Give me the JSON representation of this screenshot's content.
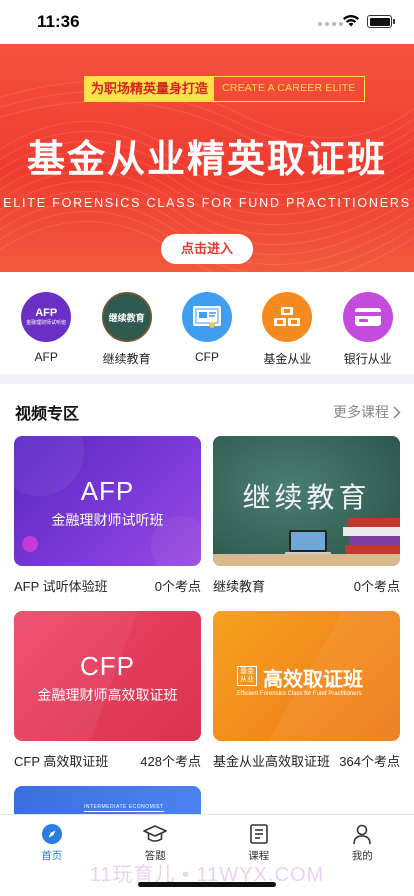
{
  "status": {
    "time": "11:36"
  },
  "banner": {
    "tag_cn": "为职场精英量身打造",
    "tag_en": "CREATE A CAREER ELITE",
    "title": "基金从业精英取证班",
    "subtitle": "ELITE FORENSICS CLASS FOR FUND PRACTITIONERS",
    "button": "点击进入",
    "colors": {
      "bg": "#ee3c30",
      "accent": "#ffe14a"
    }
  },
  "categories": [
    {
      "label": "AFP",
      "icon": "afp-badge-icon",
      "badge_title": "AFP",
      "badge_sub": "金融理财师试听班",
      "color": "#6a2fc4"
    },
    {
      "label": "继续教育",
      "icon": "chalkboard-icon",
      "badge_title": "继续教育",
      "color": "#2f5a4e"
    },
    {
      "label": "CFP",
      "icon": "certificate-icon",
      "color": "#3f9ef0"
    },
    {
      "label": "基金从业",
      "icon": "gold-bars-icon",
      "color": "#f58a1f"
    },
    {
      "label": "银行从业",
      "icon": "bank-card-icon",
      "color": "#c44bdb"
    }
  ],
  "video_section": {
    "title": "视频专区",
    "more": "更多课程"
  },
  "courses": [
    {
      "name": "AFP 试听体验班",
      "count": "0个考点",
      "thumb_title": "AFP",
      "thumb_sub": "金融理财师试听班"
    },
    {
      "name": "继续教育",
      "count": "0个考点",
      "thumb_title": "继续教育"
    },
    {
      "name": "CFP 高效取证班",
      "count": "428个考点",
      "thumb_title": "CFP",
      "thumb_sub": "金融理财师高效取证班"
    },
    {
      "name": "基金从业高效取证班",
      "count": "364个考点",
      "thumb_title": "高效取证班",
      "thumb_logo": "基金从业",
      "thumb_sub": "Efficient Forensics Class for Fund Practitioners"
    },
    {
      "thumb_caption": "INTERMEDIATE ECONOMIST"
    }
  ],
  "tabbar": [
    {
      "label": "首页",
      "icon": "compass-icon",
      "active": true
    },
    {
      "label": "答题",
      "icon": "graduation-cap-icon",
      "active": false
    },
    {
      "label": "课程",
      "icon": "book-icon",
      "active": false
    },
    {
      "label": "我的",
      "icon": "person-icon",
      "active": false
    }
  ],
  "watermark": "11玩育儿 • 11WYX.COM"
}
